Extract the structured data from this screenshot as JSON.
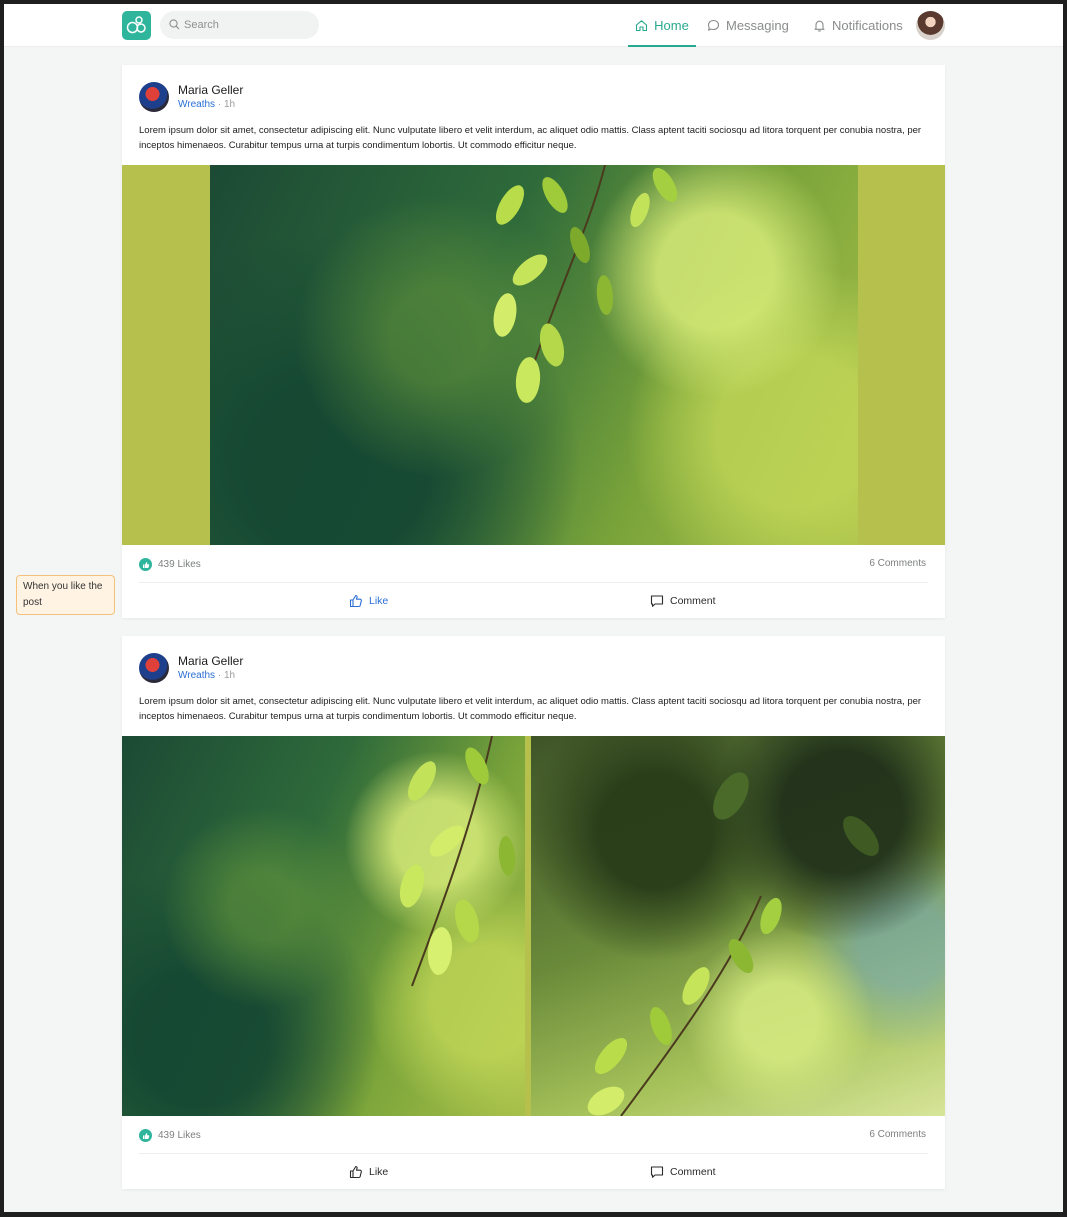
{
  "nav": {
    "search_placeholder": "Search",
    "home": "Home",
    "messaging": "Messaging",
    "notifications": "Notifications",
    "accent": "#27a98f"
  },
  "note": {
    "text": "When you like the post"
  },
  "posts": [
    {
      "author": "Maria Geller",
      "group": "Wreaths",
      "dot": "·",
      "time": "1h",
      "text": "Lorem ipsum dolor sit amet, consectetur adipiscing elit. Nunc vulputate libero et velit interdum, ac aliquet odio mattis. Class aptent taciti sociosqu ad litora torquent per conubia nostra, per inceptos himenaeos. Curabitur tempus urna at turpis condimentum lobortis. Ut commodo efficitur neque.",
      "likes": "439 Likes",
      "comments": "6 Comments",
      "like_label": "Like",
      "comment_label": "Comment",
      "liked": true
    },
    {
      "author": "Maria Geller",
      "group": "Wreaths",
      "dot": "·",
      "time": "1h",
      "text": "Lorem ipsum dolor sit amet, consectetur adipiscing elit. Nunc vulputate libero et velit interdum, ac aliquet odio mattis. Class aptent taciti sociosqu ad litora torquent per conubia nostra, per inceptos himenaeos. Curabitur tempus urna at turpis condimentum lobortis. Ut commodo efficitur neque.",
      "likes": "439 Likes",
      "comments": "6 Comments",
      "like_label": "Like",
      "comment_label": "Comment",
      "liked": false
    }
  ]
}
